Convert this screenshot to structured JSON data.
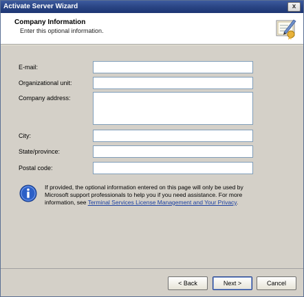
{
  "window": {
    "title": "Activate Server Wizard",
    "close_glyph": "x"
  },
  "header": {
    "title": "Company Information",
    "subtitle": "Enter this optional information.",
    "icon": "certificate-pen-icon"
  },
  "form": {
    "fields": [
      {
        "label": "E-mail:",
        "value": ""
      },
      {
        "label": "Organizational unit:",
        "value": ""
      },
      {
        "label": "Company address:",
        "value": ""
      },
      {
        "label": "City:",
        "value": ""
      },
      {
        "label": "State/province:",
        "value": ""
      },
      {
        "label": "Postal code:",
        "value": ""
      }
    ]
  },
  "info": {
    "icon": "info-icon",
    "text_before": "If provided, the optional information entered on this page will only be used by Microsoft support professionals to help you if you need assistance. For more information, see ",
    "link_text": "Terminal Services License Management and Your Privacy",
    "text_after": "."
  },
  "buttons": {
    "back": "< Back",
    "next": "Next >",
    "cancel": "Cancel"
  },
  "colors": {
    "titlebar": "#2a4584",
    "panel": "#d4d0c8",
    "link": "#1a3fa0",
    "info_icon": "#2b5fc7"
  }
}
